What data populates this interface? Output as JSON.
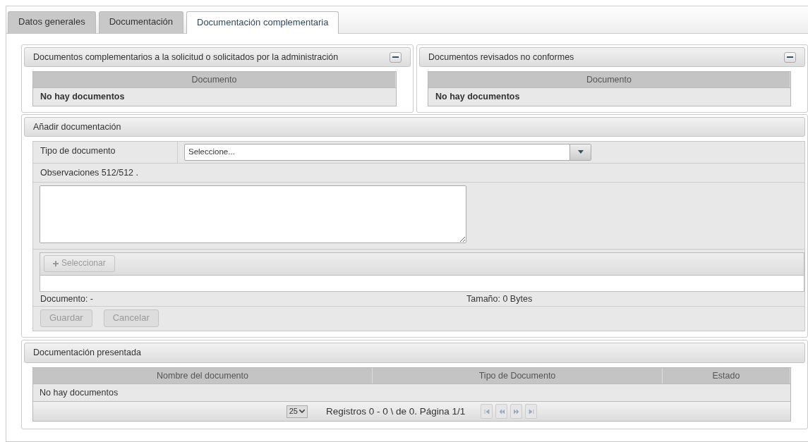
{
  "tabs": [
    {
      "label": "Datos generales",
      "selected": false
    },
    {
      "label": "Documentación",
      "selected": false
    },
    {
      "label": "Documentación complementaria",
      "selected": true
    }
  ],
  "top_panels": [
    {
      "title": "Documentos complementarios a la solicitud o solicitados por la administración",
      "expanded": true,
      "column": "Documento",
      "empty": "No hay documentos"
    },
    {
      "title": "Documentos revisados no conformes",
      "expanded": true,
      "column": "Documento",
      "empty": "No hay documentos"
    }
  ],
  "add_form": {
    "title": "Añadir documentación",
    "type_label": "Tipo de documento",
    "type_value": "Seleccione...",
    "observations_label": "Observaciones 512/512 .",
    "upload_button": {
      "label": "Seleccionar",
      "disabled": true
    },
    "document_label": "Documento: -",
    "size_label": "Tamaño: 0 Bytes",
    "buttons": [
      {
        "label": "Guardar",
        "disabled": true
      },
      {
        "label": "Cancelar",
        "disabled": true
      }
    ]
  },
  "presented": {
    "title": "Documentación presentada",
    "columns": [
      "Nombre del documento",
      "Tipo de Documento",
      "Estado"
    ],
    "empty": "No hay documentos",
    "pager": {
      "page_size": "25",
      "info": "Registros 0 - 0 \\ de 0. Página 1/1",
      "nav": [
        {
          "kind": "first",
          "disabled": true
        },
        {
          "kind": "prev",
          "disabled": true
        },
        {
          "kind": "next",
          "disabled": true
        },
        {
          "kind": "last",
          "disabled": true
        }
      ]
    }
  }
}
